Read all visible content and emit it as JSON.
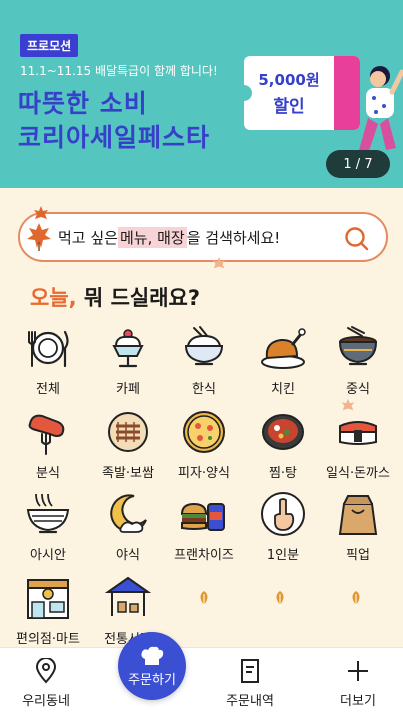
{
  "banner": {
    "badge": "프로모션",
    "subtitle": "11.1~11.15 배달특급이 함께 합니다!",
    "title_line1": "따뜻한 소비",
    "title_line2": "코리아세일페스타",
    "coupon_amount": "5,000원",
    "coupon_label": "할인",
    "page_indicator": "1 / 7",
    "background_color": "#55c6bf"
  },
  "search": {
    "prefix": "먹고 싶은 ",
    "highlight": "메뉴, 매장",
    "suffix": " 을 검색하세요!",
    "icon": "search-icon"
  },
  "section": {
    "title_accent": "오늘,",
    "title_rest": " 뭐 드실래요?"
  },
  "categories": [
    {
      "label": "전체",
      "icon": "plate-cutlery-icon"
    },
    {
      "label": "카페",
      "icon": "parfait-icon"
    },
    {
      "label": "한식",
      "icon": "rice-bowl-icon"
    },
    {
      "label": "치킨",
      "icon": "roast-chicken-icon"
    },
    {
      "label": "중식",
      "icon": "noodle-bowl-icon"
    },
    {
      "label": "분식",
      "icon": "sausage-fork-icon"
    },
    {
      "label": "족발·보쌈",
      "icon": "pork-platter-icon"
    },
    {
      "label": "피자·양식",
      "icon": "pizza-icon"
    },
    {
      "label": "찜·탕",
      "icon": "hot-pot-icon"
    },
    {
      "label": "일식·돈까스",
      "icon": "sushi-icon"
    },
    {
      "label": "아시안",
      "icon": "pho-bowl-icon"
    },
    {
      "label": "야식",
      "icon": "moon-icon"
    },
    {
      "label": "프랜차이즈",
      "icon": "burger-drink-icon"
    },
    {
      "label": "1인분",
      "icon": "one-finger-icon"
    },
    {
      "label": "픽업",
      "icon": "paper-bag-icon"
    },
    {
      "label": "편의점·마트",
      "icon": "convenience-store-icon"
    },
    {
      "label": "전통시장",
      "icon": "market-stall-icon"
    }
  ],
  "bottom_nav": {
    "neighborhood": "우리동네",
    "order": "주문하기",
    "history": "주문내역",
    "more": "더보기"
  },
  "colors": {
    "accent": "#e86a2e",
    "primary": "#3a4fd1",
    "background": "#fdf3e1"
  }
}
